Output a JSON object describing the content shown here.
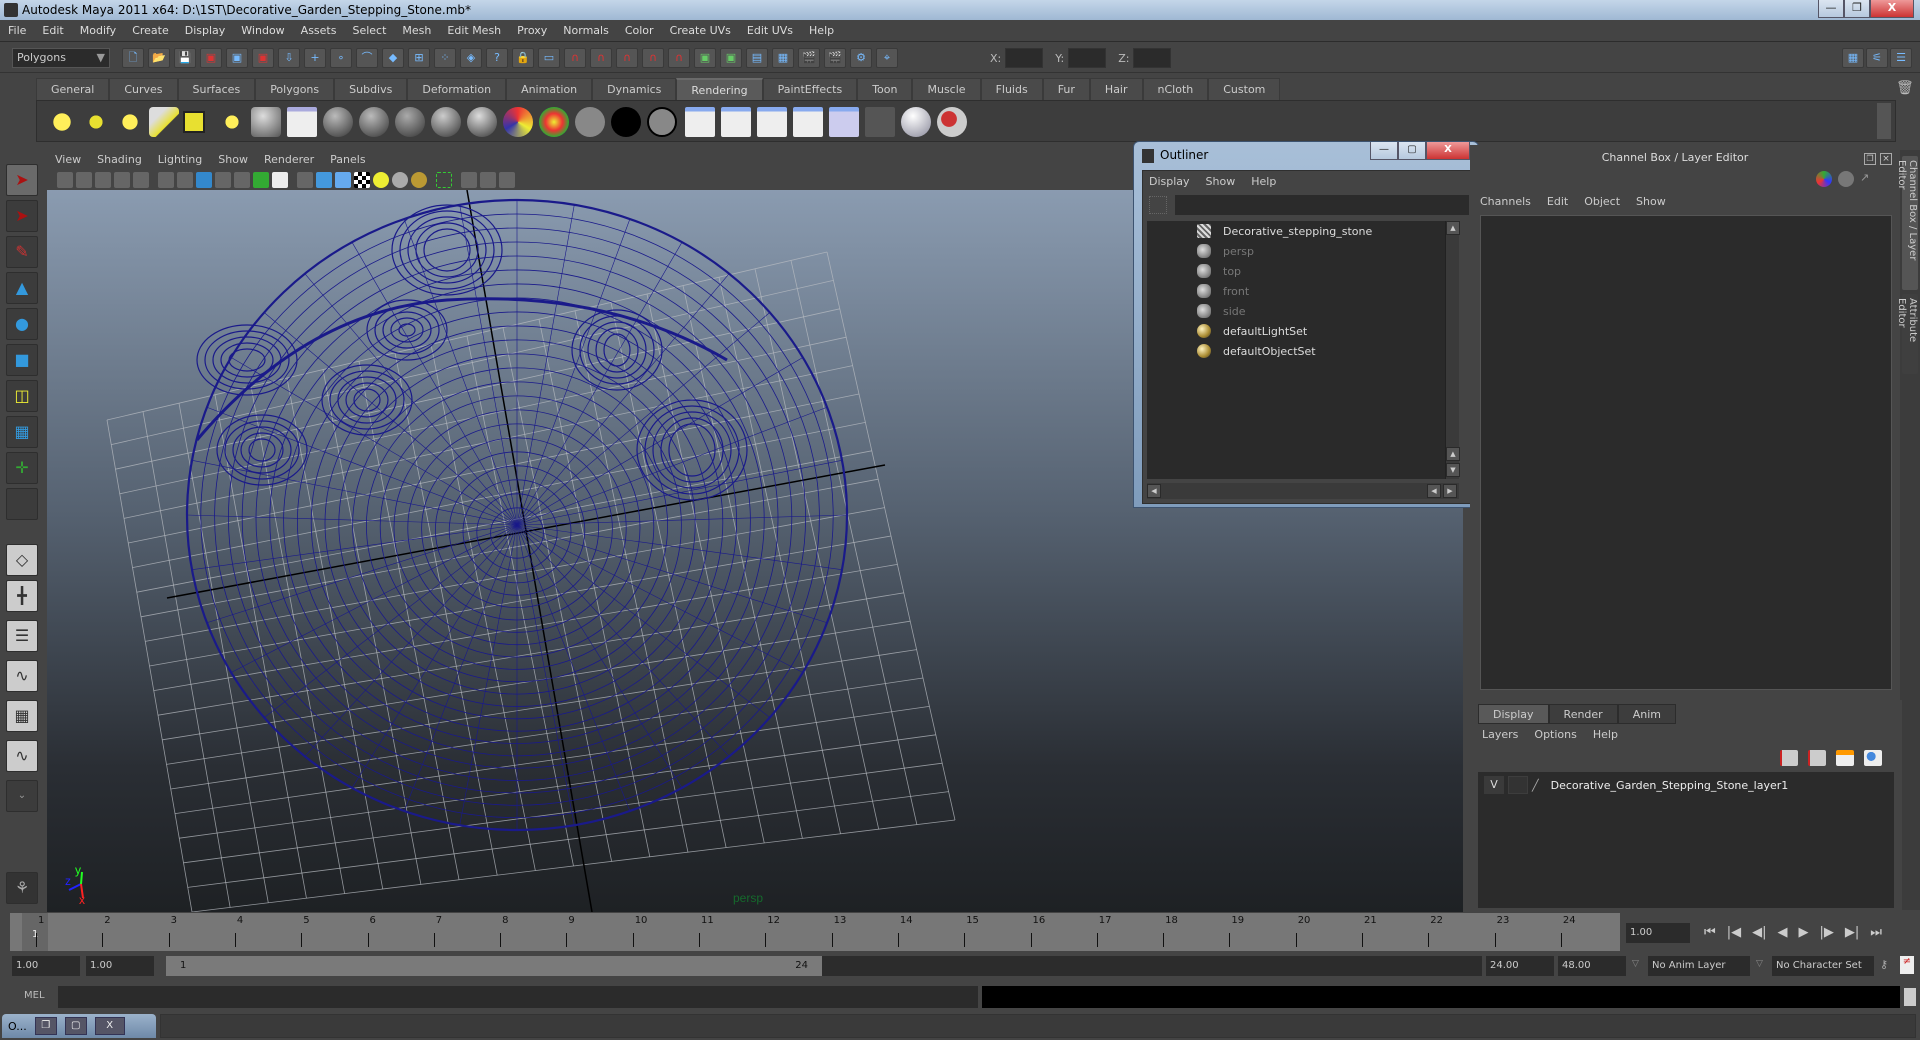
{
  "window": {
    "title": "Autodesk Maya 2011 x64: D:\\1ST\\Decorative_Garden_Stepping_Stone.mb*",
    "buttons": {
      "minimize": "—",
      "restore": "❐",
      "close": "X"
    }
  },
  "menubar": [
    "File",
    "Edit",
    "Modify",
    "Create",
    "Display",
    "Window",
    "Assets",
    "Select",
    "Mesh",
    "Edit Mesh",
    "Proxy",
    "Normals",
    "Color",
    "Create UVs",
    "Edit UVs",
    "Help"
  ],
  "statusline": {
    "menuset": "Polygons",
    "coord_labels": {
      "x": "X:",
      "y": "Y:",
      "z": "Z:"
    }
  },
  "shelf": {
    "tabs": [
      "General",
      "Curves",
      "Surfaces",
      "Polygons",
      "Subdivs",
      "Deformation",
      "Animation",
      "Dynamics",
      "Rendering",
      "PaintEffects",
      "Toon",
      "Muscle",
      "Fluids",
      "Fur",
      "Hair",
      "nCloth",
      "Custom"
    ],
    "active_tab": "Rendering",
    "icons": [
      "ambient-light-icon",
      "directional-light-icon",
      "point-light-icon",
      "spot-light-icon",
      "area-light-icon",
      "volume-light-icon",
      "camera-icon",
      "hypershade-icon",
      "blinn-icon",
      "lambert-icon",
      "phong-icon",
      "phonge-icon",
      "anisotropic-icon",
      "layered-shader-icon",
      "ramp-shader-icon",
      "surface-shader-icon",
      "use-background-icon",
      "shading-map-icon",
      "render-icon",
      "ipr-render-icon",
      "batch-render-icon",
      "render-settings-icon",
      "render-view-icon",
      "delete-render-icon",
      "hardware-render-icon",
      "paint-render-icon"
    ]
  },
  "viewport": {
    "menu": [
      "View",
      "Shading",
      "Lighting",
      "Show",
      "Renderer",
      "Panels"
    ],
    "camera_label": "persp",
    "axis": {
      "x": "x",
      "y": "y",
      "z": "z"
    },
    "wire_color": "#1a1a8a"
  },
  "outliner": {
    "title": "Outliner",
    "menu": [
      "Display",
      "Show",
      "Help"
    ],
    "items": [
      {
        "label": "Decorative_stepping_stone",
        "type": "mesh",
        "dim": false
      },
      {
        "label": "persp",
        "type": "camera",
        "dim": true
      },
      {
        "label": "top",
        "type": "camera",
        "dim": true
      },
      {
        "label": "front",
        "type": "camera",
        "dim": true
      },
      {
        "label": "side",
        "type": "camera",
        "dim": true
      },
      {
        "label": "defaultLightSet",
        "type": "set",
        "dim": false
      },
      {
        "label": "defaultObjectSet",
        "type": "set",
        "dim": false
      }
    ]
  },
  "channelbox": {
    "title": "Channel Box / Layer Editor",
    "menu": [
      "Channels",
      "Edit",
      "Object",
      "Show"
    ]
  },
  "side_tabs": [
    "Channel Box / Layer Editor",
    "Attribute Editor"
  ],
  "layer_editor": {
    "tabs": [
      "Display",
      "Render",
      "Anim"
    ],
    "active_tab": "Display",
    "menu": [
      "Layers",
      "Options",
      "Help"
    ],
    "layers": [
      {
        "visible": "V",
        "name": "Decorative_Garden_Stepping_Stone_layer1"
      }
    ]
  },
  "timeline": {
    "ticks": [
      "1",
      "2",
      "3",
      "4",
      "5",
      "6",
      "7",
      "8",
      "9",
      "10",
      "11",
      "12",
      "13",
      "14",
      "15",
      "16",
      "17",
      "18",
      "19",
      "20",
      "21",
      "22",
      "23",
      "24"
    ],
    "current_frame_marker": "1",
    "current_frame": "1.00"
  },
  "playback": [
    "⏮",
    "|◀",
    "◀|",
    "◀",
    "▶",
    "|▶",
    "▶|",
    "⏭"
  ],
  "range": {
    "start": "1.00",
    "playback_start": "1.00",
    "slider_start": "1",
    "slider_end": "24",
    "playback_end": "24.00",
    "end": "48.00",
    "anim_layer": "No Anim Layer",
    "character_set": "No Character Set"
  },
  "mel": {
    "label": "MEL"
  },
  "minimized": {
    "label": "O..."
  }
}
